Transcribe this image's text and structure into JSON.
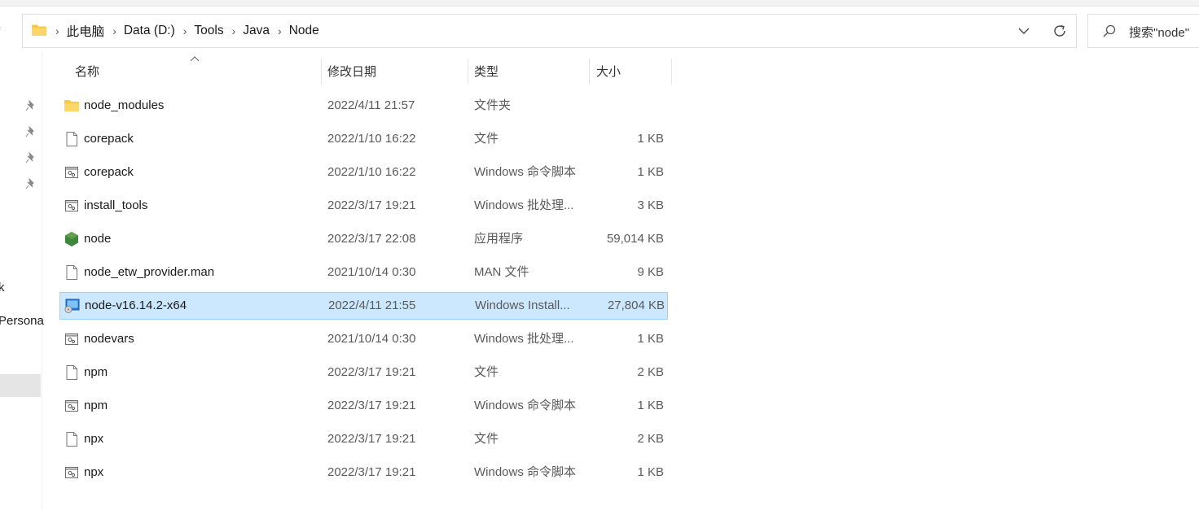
{
  "breadcrumb": [
    "此电脑",
    "Data (D:)",
    "Tools",
    "Java",
    "Node"
  ],
  "search": {
    "placeholder": "搜索\"node\""
  },
  "nav": {
    "fragments": [
      "k",
      "Persona"
    ]
  },
  "columns": {
    "name": "名称",
    "date": "修改日期",
    "type": "类型",
    "size": "大小"
  },
  "files": [
    {
      "name": "node_modules",
      "date": "2022/4/11 21:57",
      "type": "文件夹",
      "size": "",
      "icon": "folder-icon"
    },
    {
      "name": "corepack",
      "date": "2022/1/10 16:22",
      "type": "文件",
      "size": "1 KB",
      "icon": "file-icon"
    },
    {
      "name": "corepack",
      "date": "2022/1/10 16:22",
      "type": "Windows 命令脚本",
      "size": "1 KB",
      "icon": "script-icon"
    },
    {
      "name": "install_tools",
      "date": "2022/3/17 19:21",
      "type": "Windows 批处理...",
      "size": "3 KB",
      "icon": "script-icon"
    },
    {
      "name": "node",
      "date": "2022/3/17 22:08",
      "type": "应用程序",
      "size": "59,014 KB",
      "icon": "nodejs-icon"
    },
    {
      "name": "node_etw_provider.man",
      "date": "2021/10/14 0:30",
      "type": "MAN 文件",
      "size": "9 KB",
      "icon": "file-icon"
    },
    {
      "name": "node-v16.14.2-x64",
      "date": "2022/4/11 21:55",
      "type": "Windows Install...",
      "size": "27,804 KB",
      "icon": "msi-installer-icon"
    },
    {
      "name": "nodevars",
      "date": "2021/10/14 0:30",
      "type": "Windows 批处理...",
      "size": "1 KB",
      "icon": "script-icon"
    },
    {
      "name": "npm",
      "date": "2022/3/17 19:21",
      "type": "文件",
      "size": "2 KB",
      "icon": "file-icon"
    },
    {
      "name": "npm",
      "date": "2022/3/17 19:21",
      "type": "Windows 命令脚本",
      "size": "1 KB",
      "icon": "script-icon"
    },
    {
      "name": "npx",
      "date": "2022/3/17 19:21",
      "type": "文件",
      "size": "2 KB",
      "icon": "file-icon"
    },
    {
      "name": "npx",
      "date": "2022/3/17 19:21",
      "type": "Windows 命令脚本",
      "size": "1 KB",
      "icon": "script-icon"
    }
  ],
  "selected_index": 6,
  "colors": {
    "selection_bg": "#cce8ff",
    "selection_border": "#99d1ff",
    "folder": "#f8c93f",
    "nodejs": "#3c873a"
  }
}
